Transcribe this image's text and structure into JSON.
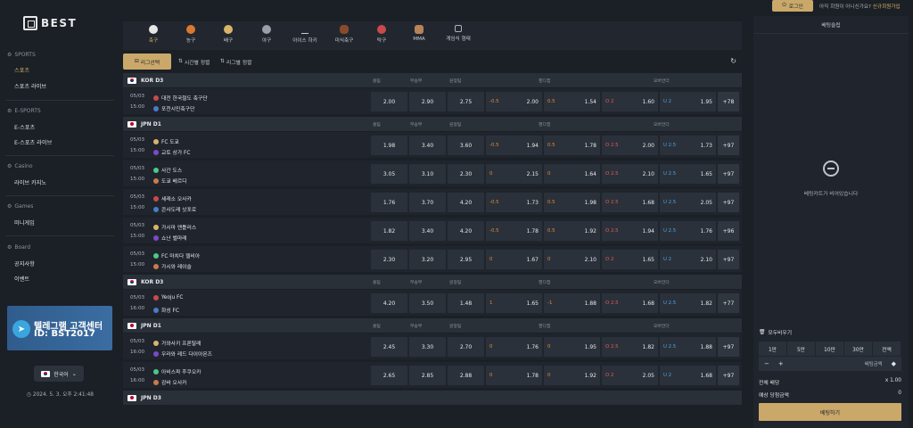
{
  "brand": {
    "name": "BEST"
  },
  "sidebar": {
    "sections": [
      {
        "title": "SPORTS",
        "items": [
          {
            "label": "스포츠",
            "active": true
          },
          {
            "label": "스포츠 라이브"
          }
        ]
      },
      {
        "title": "E-SPORTS",
        "items": [
          {
            "label": "E-스포츠"
          },
          {
            "label": "E-스포츠 라이브"
          }
        ]
      },
      {
        "title": "Casino",
        "items": [
          {
            "label": "라이브 카지노"
          }
        ]
      },
      {
        "title": "Games",
        "items": [
          {
            "label": "미니게임"
          }
        ]
      },
      {
        "title": "Board",
        "items": [
          {
            "label": "공지사항"
          },
          {
            "label": "이벤트"
          }
        ]
      }
    ],
    "banner": {
      "line1": "텔레그램 고객센터",
      "line2": "ID: BST2017"
    },
    "language": "한국어",
    "clock": "2024. 5. 3. 오후 2:41:48"
  },
  "sports": [
    {
      "label": "축구",
      "active": true,
      "icon": "soccer-icon"
    },
    {
      "label": "농구",
      "icon": "basketball-icon"
    },
    {
      "label": "배구",
      "icon": "volleyball-icon"
    },
    {
      "label": "야구",
      "icon": "baseball-icon"
    },
    {
      "label": "아이스 하키",
      "icon": "hockey-icon"
    },
    {
      "label": "미식축구",
      "icon": "football-icon"
    },
    {
      "label": "탁구",
      "icon": "pingpong-icon"
    },
    {
      "label": "MMA",
      "icon": "mma-icon"
    },
    {
      "label": "게임식 형태",
      "icon": "game-icon"
    }
  ],
  "filters": {
    "league": "리그선택",
    "time": "시간별 정렬",
    "league_sort": "리그별 정렬"
  },
  "columns": {
    "home": "홈팀",
    "draw": "무승부",
    "away": "원정팀",
    "handicap": "핸디캡",
    "overunder": "오버언더"
  },
  "groups": [
    {
      "league": "KOR D3",
      "flag": "kr",
      "matches": [
        {
          "date": "05/03",
          "time": "15:00",
          "home": "대전 한국철도 축구단",
          "away": "포천시민축구단",
          "h": "2.00",
          "d": "2.90",
          "a": "2.75",
          "hcp": "-0.5",
          "hcp_o1": "2.00",
          "hcp2": "0.5",
          "hcp_o2": "1.54",
          "ov": "O 2",
          "ov_o": "1.60",
          "un": "U 2",
          "un_o": "1.95",
          "more": "+78"
        }
      ]
    },
    {
      "league": "JPN D1",
      "flag": "jp",
      "matches": [
        {
          "date": "05/03",
          "time": "15:00",
          "home": "FC 도쿄",
          "away": "교토 상가 FC",
          "h": "1.98",
          "d": "3.40",
          "a": "3.60",
          "hcp": "-0.5",
          "hcp_o1": "1.94",
          "hcp2": "0.5",
          "hcp_o2": "1.78",
          "ov": "O 2.5",
          "ov_o": "2.00",
          "un": "U 2.5",
          "un_o": "1.73",
          "more": "+97"
        },
        {
          "date": "05/03",
          "time": "15:00",
          "home": "사간 도스",
          "away": "도쿄 베르디",
          "h": "3.05",
          "d": "3.10",
          "a": "2.30",
          "hcp": "0",
          "hcp_o1": "2.15",
          "hcp2": "0",
          "hcp_o2": "1.64",
          "ov": "O 2.5",
          "ov_o": "2.10",
          "un": "U 2.5",
          "un_o": "1.65",
          "more": "+97"
        },
        {
          "date": "05/03",
          "time": "15:00",
          "home": "세레소 오사카",
          "away": "콘사도레 삿포로",
          "h": "1.76",
          "d": "3.70",
          "a": "4.20",
          "hcp": "-0.5",
          "hcp_o1": "1.73",
          "hcp2": "0.5",
          "hcp_o2": "1.98",
          "ov": "O 2.5",
          "ov_o": "1.68",
          "un": "U 2.5",
          "un_o": "2.05",
          "more": "+97"
        },
        {
          "date": "05/03",
          "time": "15:00",
          "home": "가시마 앤틀러스",
          "away": "쇼난 벨마레",
          "h": "1.82",
          "d": "3.40",
          "a": "4.20",
          "hcp": "-0.5",
          "hcp_o1": "1.78",
          "hcp2": "0.5",
          "hcp_o2": "1.92",
          "ov": "O 2.5",
          "ov_o": "1.94",
          "un": "U 2.5",
          "un_o": "1.76",
          "more": "+96"
        },
        {
          "date": "05/03",
          "time": "15:00",
          "home": "FC 마치다 젤비아",
          "away": "가시와 레이솔",
          "h": "2.30",
          "d": "3.20",
          "a": "2.95",
          "hcp": "0",
          "hcp_o1": "1.67",
          "hcp2": "0",
          "hcp_o2": "2.10",
          "ov": "O 2",
          "ov_o": "1.65",
          "un": "U 2",
          "un_o": "2.10",
          "more": "+97"
        }
      ]
    },
    {
      "league": "KOR D3",
      "flag": "kr",
      "matches": [
        {
          "date": "05/03",
          "time": "16:00",
          "home": "Yeoju FC",
          "away": "화성 FC",
          "h": "4.20",
          "d": "3.50",
          "a": "1.48",
          "hcp": "1",
          "hcp_o1": "1.65",
          "hcp2": "-1",
          "hcp_o2": "1.88",
          "ov": "O 2.5",
          "ov_o": "1.68",
          "un": "U 2.5",
          "un_o": "1.82",
          "more": "+77"
        }
      ]
    },
    {
      "league": "JPN D1",
      "flag": "jp",
      "matches": [
        {
          "date": "05/03",
          "time": "16:00",
          "home": "가와사키 프론탈레",
          "away": "우라와 레드 다이아몬즈",
          "h": "2.45",
          "d": "3.30",
          "a": "2.70",
          "hcp": "0",
          "hcp_o1": "1.76",
          "hcp2": "0",
          "hcp_o2": "1.95",
          "ov": "O 2.5",
          "ov_o": "1.82",
          "un": "U 2.5",
          "un_o": "1.88",
          "more": "+97"
        },
        {
          "date": "05/03",
          "time": "16:00",
          "home": "아비스파 후쿠오카",
          "away": "감바 오사카",
          "h": "2.65",
          "d": "2.85",
          "a": "2.88",
          "hcp": "0",
          "hcp_o1": "1.78",
          "hcp2": "0",
          "hcp_o2": "1.92",
          "ov": "O 2",
          "ov_o": "2.05",
          "un": "U 2",
          "un_o": "1.68",
          "more": "+97"
        }
      ]
    },
    {
      "league": "JPN D3",
      "flag": "jp",
      "matches": []
    }
  ],
  "top": {
    "login": "로그인",
    "join_q": "아직 회원이 아니신가요?",
    "join_link": "신규회원가입"
  },
  "slip": {
    "title": "베팅슬립",
    "empty": "베팅카트가 비어있습니다",
    "clear": "모두비우기",
    "amounts": [
      "1만",
      "5만",
      "10만",
      "30만",
      "전액"
    ],
    "stake_placeholder": "베팅금액",
    "total_odds_label": "전체 배당",
    "total_odds": "x 1.00",
    "win_label": "예상 당첨금액",
    "win": "0",
    "bet_button": "베팅하기"
  }
}
